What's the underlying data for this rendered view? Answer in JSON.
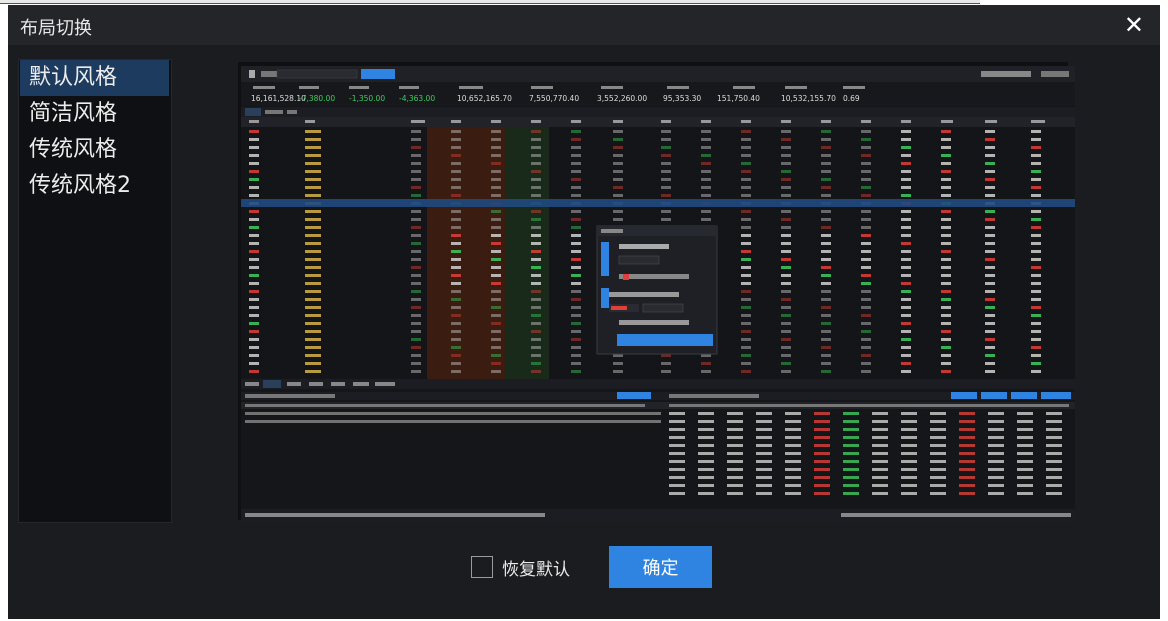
{
  "dialog": {
    "title": "布局切换",
    "close_icon": "close-icon"
  },
  "sidebar": {
    "items": [
      {
        "label": "默认风格",
        "active": true
      },
      {
        "label": "简洁风格",
        "active": false
      },
      {
        "label": "传统风格",
        "active": false
      },
      {
        "label": "传统风格2",
        "active": false
      }
    ]
  },
  "preview": {
    "description_icon": "layout-preview-thumbnail",
    "stats": [
      "16,161,528.10",
      "-7,380.00",
      "-1,350.00",
      "-4,363.00",
      "10,652,165.70",
      "7,550,770.40",
      "3,552,260.00",
      "95,353.30",
      "151,750.40",
      "10,532,155.70",
      "0.69"
    ]
  },
  "footer": {
    "restore_label": "恢复默认",
    "restore_checked": false,
    "confirm_label": "确定"
  },
  "colors": {
    "accent": "#2f84e2",
    "active_item": "#1d3b5e",
    "background": "#1b1c1f"
  }
}
